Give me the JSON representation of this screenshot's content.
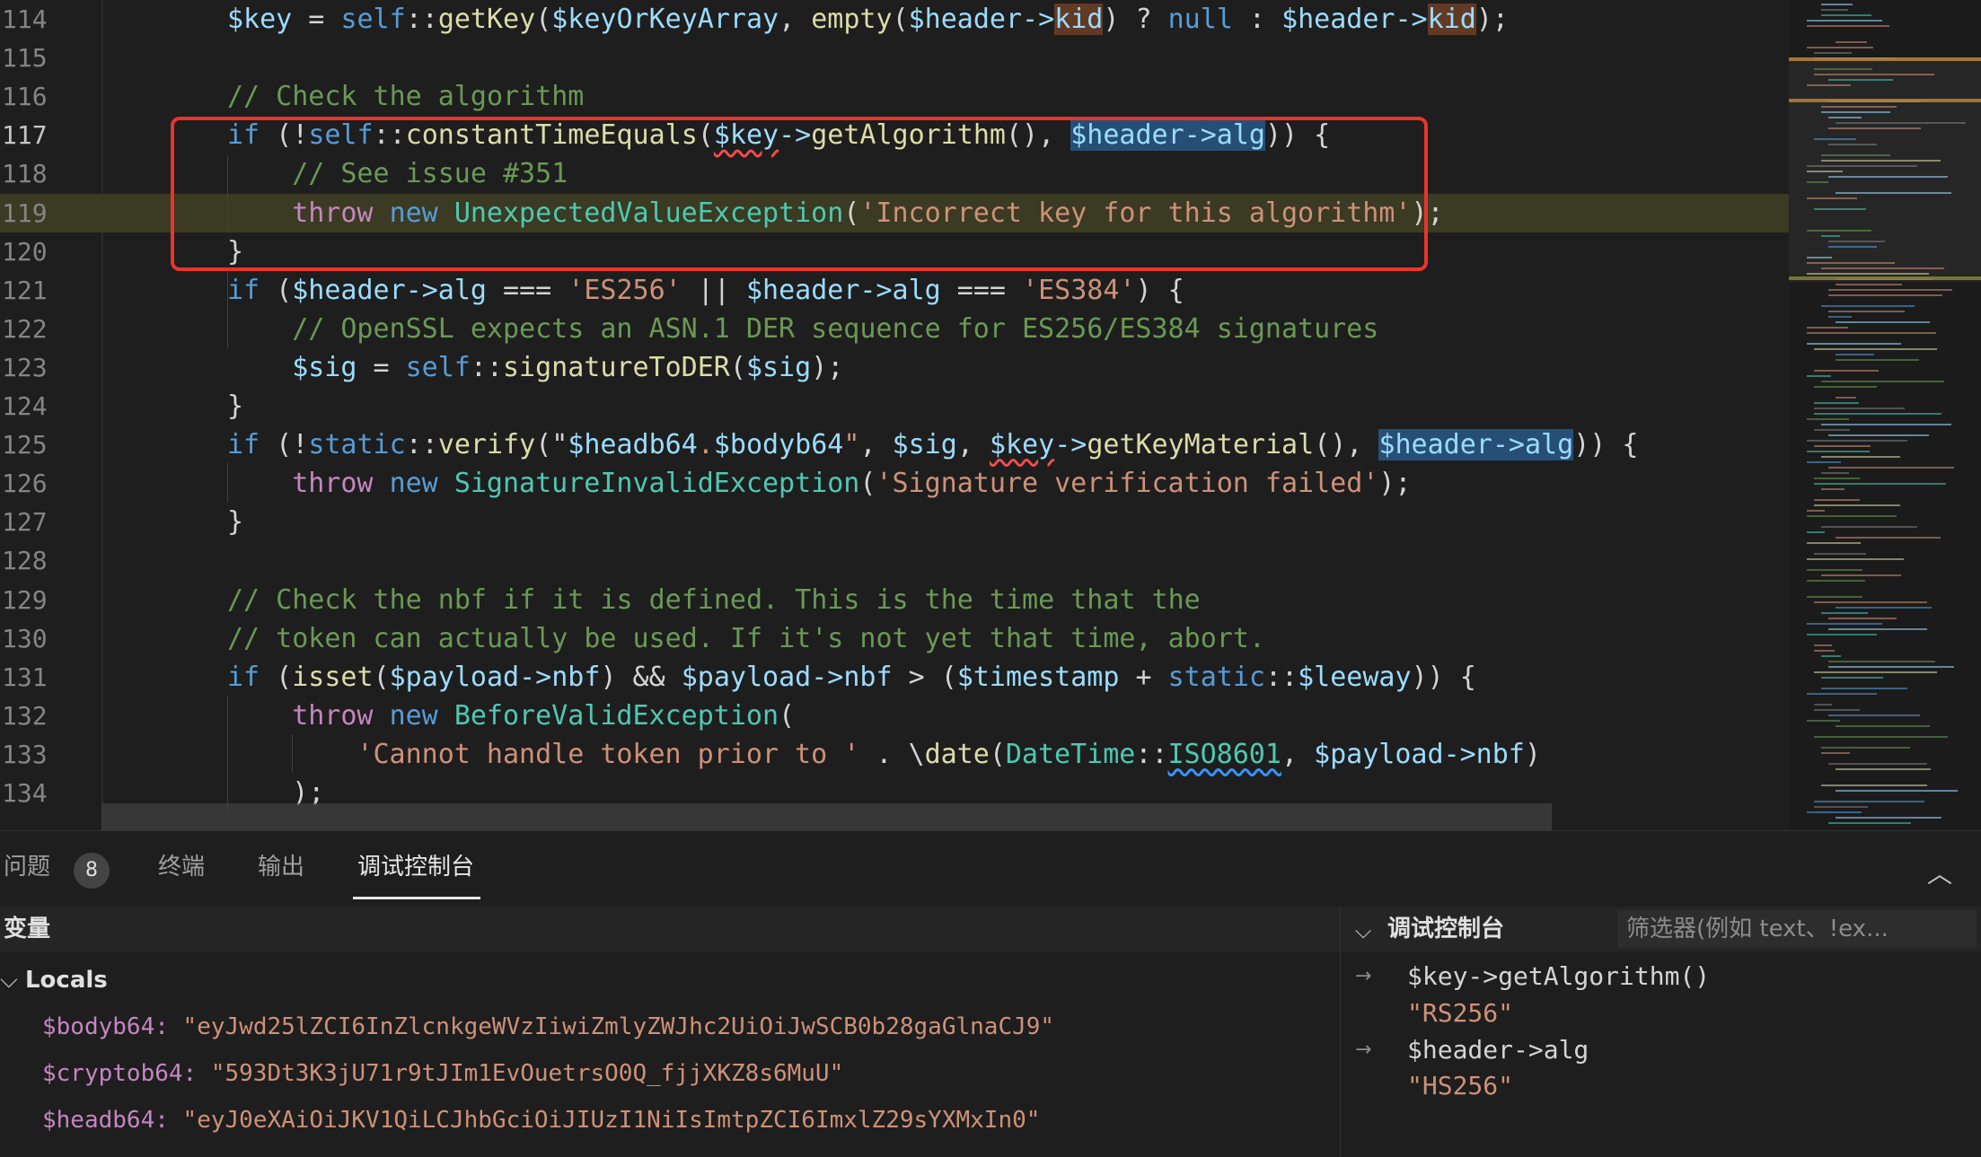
{
  "editor": {
    "lines": [
      {
        "n": "114",
        "tokens": [
          [
            "var",
            "$key"
          ],
          [
            "op",
            " = "
          ],
          [
            "kw",
            "self"
          ],
          [
            "op",
            "::"
          ],
          [
            "fn",
            "getKey"
          ],
          [
            "op",
            "("
          ],
          [
            "var",
            "$keyOrKeyArray"
          ],
          [
            "op",
            ", "
          ],
          [
            "fn",
            "empty"
          ],
          [
            "op",
            "("
          ],
          [
            "var",
            "$header->"
          ],
          [
            "hlkid",
            "kid"
          ],
          [
            "op",
            ") ? "
          ],
          [
            "kw",
            "null"
          ],
          [
            "op",
            " : "
          ],
          [
            "var",
            "$header->"
          ],
          [
            "hlkid",
            "kid"
          ],
          [
            "op",
            ");"
          ]
        ]
      },
      {
        "n": "115",
        "tokens": []
      },
      {
        "n": "116",
        "tokens": [
          [
            "cmt",
            "// Check the algorithm"
          ]
        ]
      },
      {
        "n": "117",
        "tokens": [
          [
            "kw",
            "if"
          ],
          [
            "op",
            " (!"
          ],
          [
            "kw",
            "self"
          ],
          [
            "op",
            "::"
          ],
          [
            "fn",
            "constantTimeEquals"
          ],
          [
            "op",
            "("
          ],
          [
            "squig",
            "$key"
          ],
          [
            "var",
            "->"
          ],
          [
            "fn",
            "getAlgorithm"
          ],
          [
            "op",
            "(), "
          ],
          [
            "sel",
            "$header->alg"
          ],
          [
            "op",
            ")) {"
          ]
        ]
      },
      {
        "n": "118",
        "tokens": [
          [
            "cmt",
            "// See issue #351"
          ]
        ]
      },
      {
        "n": "119",
        "tokens": [
          [
            "throw",
            "throw"
          ],
          [
            "op",
            " "
          ],
          [
            "kw",
            "new"
          ],
          [
            "op",
            " "
          ],
          [
            "cls",
            "UnexpectedValueException"
          ],
          [
            "op",
            "("
          ],
          [
            "str",
            "'Incorrect key for this algorithm'"
          ],
          [
            "op",
            ");"
          ]
        ]
      },
      {
        "n": "120",
        "tokens": [
          [
            "op",
            "}"
          ]
        ]
      },
      {
        "n": "121",
        "tokens": [
          [
            "kw",
            "if"
          ],
          [
            "op",
            " ("
          ],
          [
            "var",
            "$header->alg"
          ],
          [
            "op",
            " === "
          ],
          [
            "str",
            "'ES256'"
          ],
          [
            "op",
            " || "
          ],
          [
            "var",
            "$header->alg"
          ],
          [
            "op",
            " === "
          ],
          [
            "str",
            "'ES384'"
          ],
          [
            "op",
            ") {"
          ]
        ]
      },
      {
        "n": "122",
        "tokens": [
          [
            "cmt",
            "// OpenSSL expects an ASN.1 DER sequence for ES256/ES384 signatures"
          ]
        ]
      },
      {
        "n": "123",
        "tokens": [
          [
            "var",
            "$sig"
          ],
          [
            "op",
            " = "
          ],
          [
            "kw",
            "self"
          ],
          [
            "op",
            "::"
          ],
          [
            "fn",
            "signatureToDER"
          ],
          [
            "op",
            "("
          ],
          [
            "var",
            "$sig"
          ],
          [
            "op",
            ");"
          ]
        ]
      },
      {
        "n": "124",
        "tokens": [
          [
            "op",
            "}"
          ]
        ]
      },
      {
        "n": "125",
        "tokens": [
          [
            "kw",
            "if"
          ],
          [
            "op",
            " (!"
          ],
          [
            "kw",
            "static"
          ],
          [
            "op",
            "::"
          ],
          [
            "fn",
            "verify"
          ],
          [
            "op",
            "(\""
          ],
          [
            "var",
            "$headb64"
          ],
          [
            "str",
            "."
          ],
          [
            "var",
            "$bodyb64"
          ],
          [
            "str",
            "\""
          ],
          [
            "op",
            ", "
          ],
          [
            "var",
            "$sig"
          ],
          [
            "op",
            ", "
          ],
          [
            "squig",
            "$key"
          ],
          [
            "var",
            "->"
          ],
          [
            "fn",
            "getKeyMaterial"
          ],
          [
            "op",
            "(), "
          ],
          [
            "sel",
            "$header->alg"
          ],
          [
            "op",
            ")) {"
          ]
        ]
      },
      {
        "n": "126",
        "tokens": [
          [
            "throw",
            "throw"
          ],
          [
            "op",
            " "
          ],
          [
            "kw",
            "new"
          ],
          [
            "op",
            " "
          ],
          [
            "cls",
            "SignatureInvalidException"
          ],
          [
            "op",
            "("
          ],
          [
            "str",
            "'Signature verification failed'"
          ],
          [
            "op",
            ");"
          ]
        ]
      },
      {
        "n": "127",
        "tokens": [
          [
            "op",
            "}"
          ]
        ]
      },
      {
        "n": "128",
        "tokens": []
      },
      {
        "n": "129",
        "tokens": [
          [
            "cmt",
            "// Check the nbf if it is defined. This is the time that the"
          ]
        ]
      },
      {
        "n": "130",
        "tokens": [
          [
            "cmt",
            "// token can actually be used. If it's not yet that time, abort."
          ]
        ]
      },
      {
        "n": "131",
        "tokens": [
          [
            "kw",
            "if"
          ],
          [
            "op",
            " ("
          ],
          [
            "fn",
            "isset"
          ],
          [
            "op",
            "("
          ],
          [
            "var",
            "$payload->nbf"
          ],
          [
            "op",
            ") && "
          ],
          [
            "var",
            "$payload->nbf"
          ],
          [
            "op",
            " > ("
          ],
          [
            "var",
            "$timestamp"
          ],
          [
            "op",
            " + "
          ],
          [
            "kw",
            "static"
          ],
          [
            "op",
            "::"
          ],
          [
            "var",
            "$leeway"
          ],
          [
            "op",
            ")) {"
          ]
        ]
      },
      {
        "n": "132",
        "tokens": [
          [
            "throw",
            "throw"
          ],
          [
            "op",
            " "
          ],
          [
            "kw",
            "new"
          ],
          [
            "op",
            " "
          ],
          [
            "cls",
            "BeforeValidException"
          ],
          [
            "op",
            "("
          ]
        ]
      },
      {
        "n": "133",
        "tokens": [
          [
            "str",
            "'Cannot handle token prior to '"
          ],
          [
            "op",
            " . \\"
          ],
          [
            "fn",
            "date"
          ],
          [
            "op",
            "("
          ],
          [
            "cls",
            "DateTime"
          ],
          [
            "op",
            "::"
          ],
          [
            "strike",
            "ISO8601"
          ],
          [
            "op",
            ", "
          ],
          [
            "var",
            "$payload->nbf"
          ],
          [
            "op",
            ")"
          ]
        ]
      },
      {
        "n": "134",
        "tokens": [
          [
            "op",
            ");"
          ]
        ]
      }
    ]
  },
  "panel": {
    "tabs": [
      {
        "label": "问题",
        "badge": "8"
      },
      {
        "label": "终端"
      },
      {
        "label": "输出"
      },
      {
        "label": "调试控制台"
      }
    ],
    "variables": {
      "header": "变量",
      "locals_label": "Locals",
      "rows": [
        {
          "name": "$bodyb64:",
          "value": "\"eyJwd25lZCI6InZlcnkgeWVzIiwiZmlyZWJhc2UiOiJwSCB0b28gaGlnaCJ9\""
        },
        {
          "name": "$cryptob64:",
          "value": "\"593Dt3K3jU71r9tJIm1EvOuetrsO0Q_fjjXKZ8s6MuU\""
        },
        {
          "name": "$headb64:",
          "value": "\"eyJ0eXAiOiJKV1QiLCJhbGciOiJIUzI1NiIsImtpZCI6ImxlZ29sYXMxIn0\""
        }
      ]
    },
    "console": {
      "title": "调试控制台",
      "filter_placeholder": "筛选器(例如 text、!ex...",
      "entries": [
        {
          "expr": "$key->getAlgorithm()",
          "value": "\"RS256\""
        },
        {
          "expr": "$header->alg",
          "value": "\"HS256\""
        }
      ]
    }
  },
  "colors": {
    "annotation_red": "#e8352b",
    "current_line": "#3b3a23"
  }
}
